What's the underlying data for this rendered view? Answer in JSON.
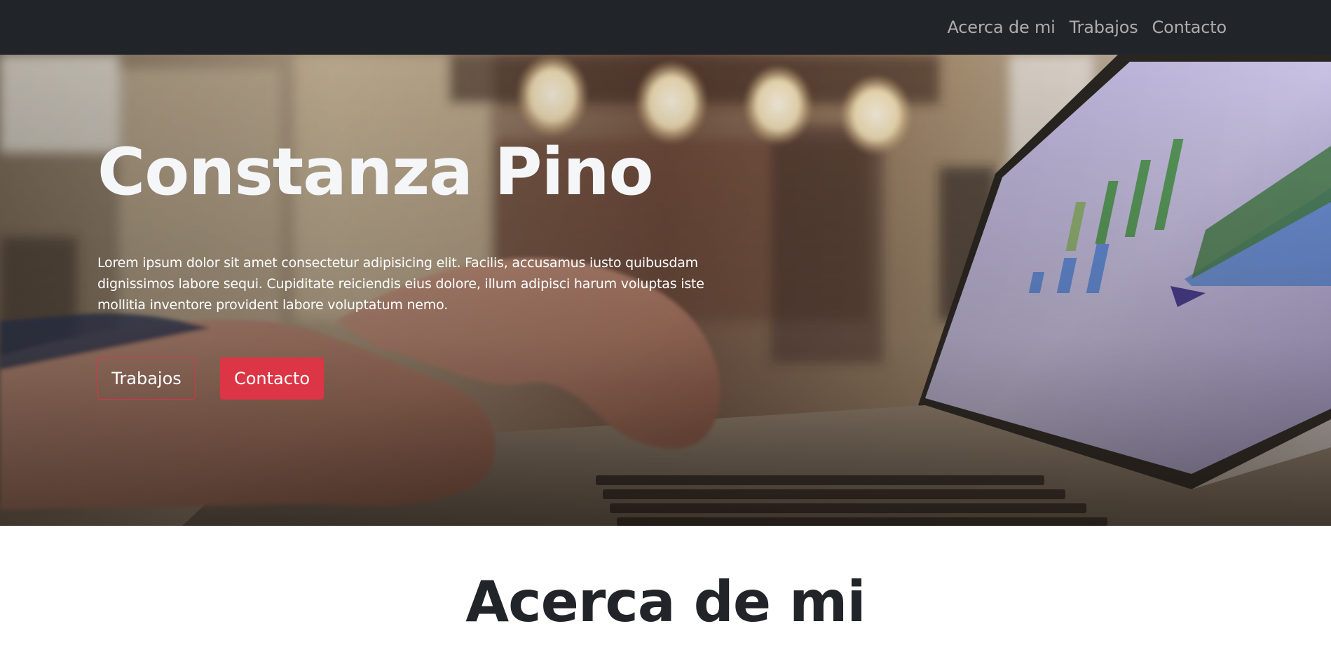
{
  "nav": {
    "links": [
      "Acerca de mi",
      "Trabajos",
      "Contacto"
    ]
  },
  "hero": {
    "title": "Constanza Pino",
    "text": "Lorem ipsum dolor sit amet consectetur adipisicing elit. Facilis, accusamus iusto quibusdam dignissimos labore sequi. Cupiditate reiciendis eius dolore, illum adipisci harum voluptas iste mollitia inventore provident labore voluptatum nemo.",
    "buttons": {
      "primary_outline": "Trabajos",
      "primary_solid": "Contacto"
    }
  },
  "about": {
    "title": "Acerca de mi"
  },
  "colors": {
    "navbar_bg": "#212529",
    "accent": "#dc3545",
    "heading_dark": "#212529"
  }
}
